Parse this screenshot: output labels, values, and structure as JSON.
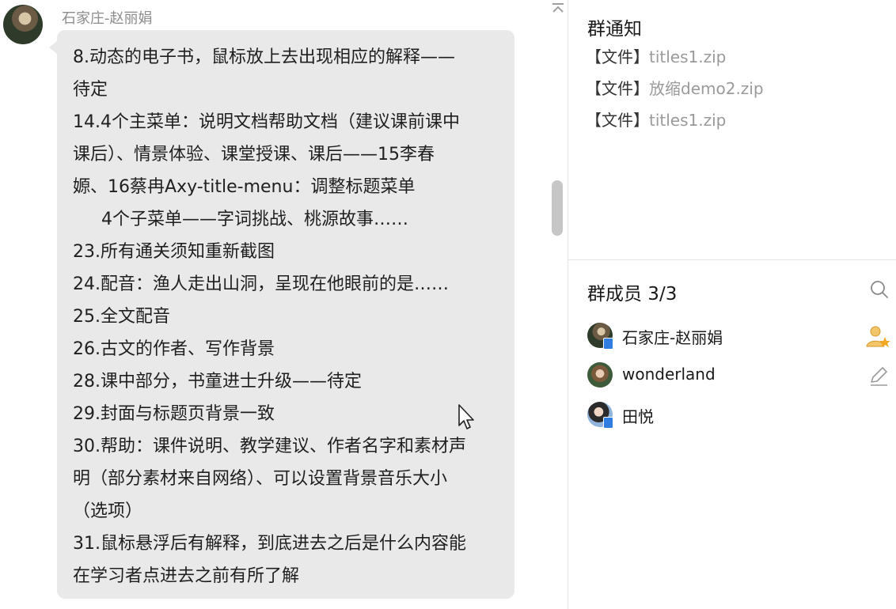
{
  "chat": {
    "sender": "石家庄-赵丽娟",
    "message_lines": [
      {
        "text": "8.动态的电子书，鼠标放上去出现相应的解释——",
        "indent": false
      },
      {
        "text": "待定",
        "indent": false
      },
      {
        "text": "14.4个主菜单：说明文档帮助文档（建议课前课中",
        "indent": false
      },
      {
        "text": "课后）、情景体验、课堂授课、课后——15李春",
        "indent": false
      },
      {
        "text": "嫄、16蔡冉Axy-title-menu：调整标题菜单",
        "indent": false
      },
      {
        "text": "4个子菜单——字词挑战、桃源故事……",
        "indent": true
      },
      {
        "text": "23.所有通关须知重新截图",
        "indent": false
      },
      {
        "text": "24.配音：渔人走出山洞，呈现在他眼前的是……",
        "indent": false
      },
      {
        "text": "25.全文配音",
        "indent": false
      },
      {
        "text": "26.古文的作者、写作背景",
        "indent": false
      },
      {
        "text": "28.课中部分，书童进士升级——待定",
        "indent": false
      },
      {
        "text": "29.封面与标题页背景一致",
        "indent": false
      },
      {
        "text": "30.帮助：课件说明、教学建议、作者名字和素材声",
        "indent": false
      },
      {
        "text": "明（部分素材来自网络）、可以设置背景音乐大小",
        "indent": false
      },
      {
        "text": "（选项）",
        "indent": false
      },
      {
        "text": "31.鼠标悬浮后有解释，到底进去之后是什么内容能",
        "indent": false
      },
      {
        "text": "在学习者点进去之前有所了解",
        "indent": false
      }
    ]
  },
  "notice": {
    "title": "群通知",
    "files": [
      {
        "tag": "【文件】",
        "name": "titles1.zip"
      },
      {
        "tag": "【文件】",
        "name": "放缩demo2.zip"
      },
      {
        "tag": "【文件】",
        "name": "titles1.zip"
      }
    ]
  },
  "members": {
    "title": "群成员 3/3",
    "list": [
      {
        "name": "石家庄-赵丽娟",
        "role_icon": "owner-icon"
      },
      {
        "name": "wonderland",
        "role_icon": "edit-icon"
      },
      {
        "name": "田悦",
        "role_icon": ""
      }
    ]
  },
  "colors": {
    "bubble": "#e9e9e9",
    "muted_text": "#9a9a9a",
    "badge": "#2f7de1",
    "owner_icon": "#f2b642"
  }
}
